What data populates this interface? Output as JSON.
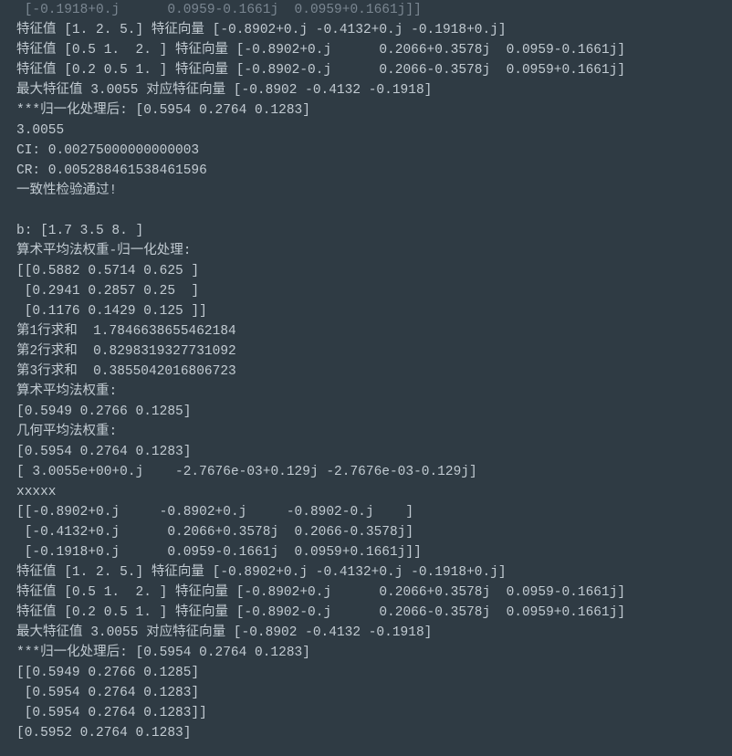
{
  "lines": [
    {
      "cls": "dim",
      "text": " [-0.1918+0.j      0.0959-0.1661j  0.0959+0.1661j]]"
    },
    {
      "text": "特征值 [1. 2. 5.] 特征向量 [-0.8902+0.j -0.4132+0.j -0.1918+0.j]"
    },
    {
      "text": "特征值 [0.5 1.  2. ] 特征向量 [-0.8902+0.j      0.2066+0.3578j  0.0959-0.1661j]"
    },
    {
      "text": "特征值 [0.2 0.5 1. ] 特征向量 [-0.8902-0.j      0.2066-0.3578j  0.0959+0.1661j]"
    },
    {
      "text": "最大特征值 3.0055 对应特征向量 [-0.8902 -0.4132 -0.1918]"
    },
    {
      "text": "***归一化处理后: [0.5954 0.2764 0.1283]"
    },
    {
      "text": "3.0055"
    },
    {
      "text": "CI: 0.00275000000000003"
    },
    {
      "text": "CR: 0.005288461538461596"
    },
    {
      "text": "一致性检验通过!"
    },
    {
      "text": ""
    },
    {
      "text": "b: [1.7 3.5 8. ]"
    },
    {
      "text": "算术平均法权重-归一化处理:"
    },
    {
      "text": "[[0.5882 0.5714 0.625 ]"
    },
    {
      "text": " [0.2941 0.2857 0.25  ]"
    },
    {
      "text": " [0.1176 0.1429 0.125 ]]"
    },
    {
      "text": "第1行求和  1.7846638655462184"
    },
    {
      "text": "第2行求和  0.8298319327731092"
    },
    {
      "text": "第3行求和  0.3855042016806723"
    },
    {
      "text": "算术平均法权重:"
    },
    {
      "text": "[0.5949 0.2766 0.1285]"
    },
    {
      "text": "几何平均法权重:"
    },
    {
      "text": "[0.5954 0.2764 0.1283]"
    },
    {
      "text": "[ 3.0055e+00+0.j    -2.7676e-03+0.129j -2.7676e-03-0.129j]"
    },
    {
      "text": "xxxxx"
    },
    {
      "text": "[[-0.8902+0.j     -0.8902+0.j     -0.8902-0.j    ]"
    },
    {
      "text": " [-0.4132+0.j      0.2066+0.3578j  0.2066-0.3578j]"
    },
    {
      "text": " [-0.1918+0.j      0.0959-0.1661j  0.0959+0.1661j]]"
    },
    {
      "text": "特征值 [1. 2. 5.] 特征向量 [-0.8902+0.j -0.4132+0.j -0.1918+0.j]"
    },
    {
      "text": "特征值 [0.5 1.  2. ] 特征向量 [-0.8902+0.j      0.2066+0.3578j  0.0959-0.1661j]"
    },
    {
      "text": "特征值 [0.2 0.5 1. ] 特征向量 [-0.8902-0.j      0.2066-0.3578j  0.0959+0.1661j]"
    },
    {
      "text": "最大特征值 3.0055 对应特征向量 [-0.8902 -0.4132 -0.1918]"
    },
    {
      "text": "***归一化处理后: [0.5954 0.2764 0.1283]"
    },
    {
      "text": "[[0.5949 0.2766 0.1285]"
    },
    {
      "text": " [0.5954 0.2764 0.1283]"
    },
    {
      "text": " [0.5954 0.2764 0.1283]]"
    },
    {
      "text": "[0.5952 0.2764 0.1283]"
    }
  ]
}
